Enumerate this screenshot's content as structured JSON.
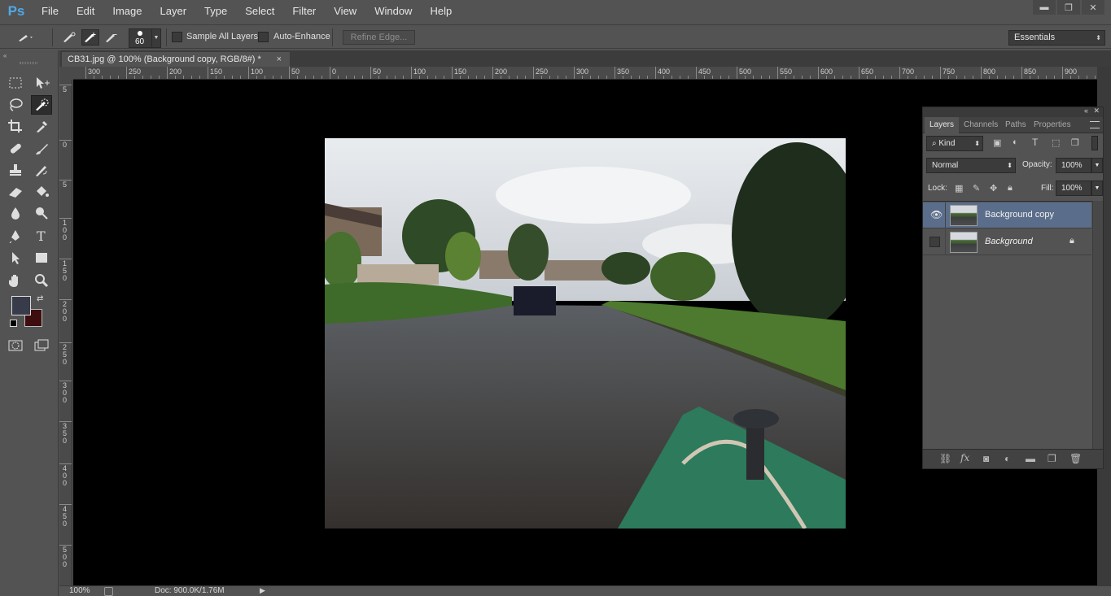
{
  "app": {
    "logo": "Ps"
  },
  "menu": [
    "File",
    "Edit",
    "Image",
    "Layer",
    "Type",
    "Select",
    "Filter",
    "View",
    "Window",
    "Help"
  ],
  "window_controls": {
    "minimize": "▬",
    "restore": "❐",
    "close": "✕"
  },
  "options": {
    "brush_size": "60",
    "sample_all_layers": "Sample All Layers",
    "auto_enhance": "Auto-Enhance",
    "refine_edge": "Refine Edge...",
    "workspace": "Essentials"
  },
  "document": {
    "tab_title": "CB31.jpg @ 100% (Background copy, RGB/8#) *",
    "close": "×"
  },
  "rulers": {
    "horizontal": [
      "300",
      "250",
      "200",
      "150",
      "100",
      "50",
      "0",
      "50",
      "100",
      "150",
      "200",
      "250",
      "300",
      "350",
      "400",
      "450",
      "500",
      "550",
      "600",
      "650",
      "700",
      "750",
      "800",
      "850",
      "900"
    ],
    "vertical": [
      "5",
      "0",
      "5",
      "100",
      "150",
      "200",
      "250",
      "300",
      "350",
      "400",
      "450",
      "500"
    ]
  },
  "status": {
    "zoom": "100%",
    "doc_info": "Doc: 900.0K/1.76M"
  },
  "layers_panel": {
    "tabs": [
      "Layers",
      "Channels",
      "Paths",
      "Properties"
    ],
    "filter_kind": "Kind",
    "blend_mode": "Normal",
    "opacity_label": "Opacity:",
    "opacity_value": "100%",
    "lock_label": "Lock:",
    "fill_label": "Fill:",
    "fill_value": "100%",
    "layers": [
      {
        "name": "Background copy",
        "visible": true,
        "selected": true
      },
      {
        "name": "Background",
        "visible": false,
        "locked": true
      }
    ]
  },
  "colors": {
    "foreground": "#373b4a",
    "background": "#3d0d0f",
    "selection_highlight": "#5a6d8a"
  }
}
